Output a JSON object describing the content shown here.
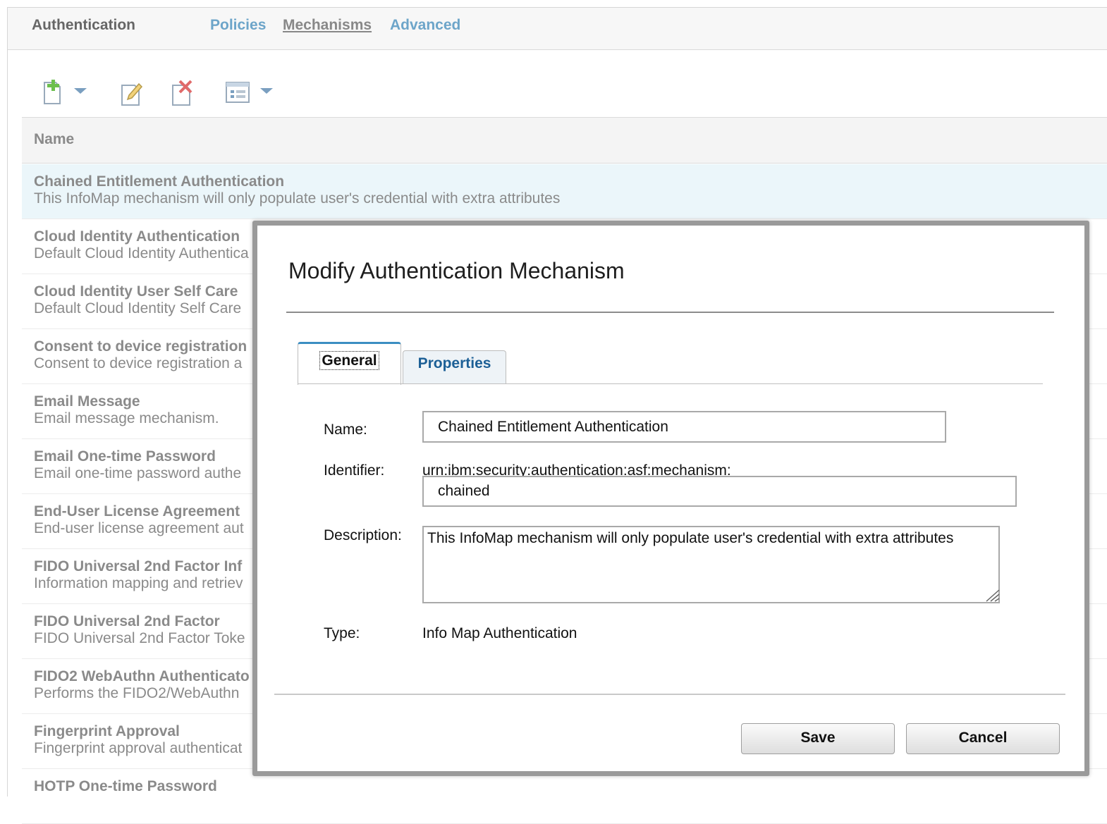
{
  "header": {
    "title": "Authentication",
    "nav": [
      {
        "label": "Policies",
        "active": false
      },
      {
        "label": "Mechanisms",
        "active": true
      },
      {
        "label": "Advanced",
        "active": false
      }
    ]
  },
  "toolbar": {
    "buttons": [
      "add-icon",
      "edit-icon",
      "delete-icon",
      "columns-icon"
    ]
  },
  "grid": {
    "column_header": "Name",
    "rows": [
      {
        "name": "Chained Entitlement Authentication",
        "description": "This InfoMap mechanism will only populate user's credential with extra attributes",
        "selected": true
      },
      {
        "name": "Cloud Identity Authentication",
        "description": "Default Cloud Identity Authentica"
      },
      {
        "name": "Cloud Identity User Self Care",
        "description": "Default Cloud Identity Self Care"
      },
      {
        "name": "Consent to device registration",
        "description": "Consent to device registration a"
      },
      {
        "name": "Email Message",
        "description": "Email message mechanism."
      },
      {
        "name": "Email One-time Password",
        "description": "Email one-time password authe"
      },
      {
        "name": "End-User License Agreement",
        "description": "End-user license agreement aut"
      },
      {
        "name": "FIDO Universal 2nd Factor Inf",
        "description": "Information mapping and retriev"
      },
      {
        "name": "FIDO Universal 2nd Factor",
        "description": "FIDO Universal 2nd Factor Toke"
      },
      {
        "name": "FIDO2 WebAuthn Authenticato",
        "description": "Performs the FIDO2/WebAuthn"
      },
      {
        "name": "Fingerprint Approval",
        "description": "Fingerprint approval authenticat"
      },
      {
        "name": "HOTP One-time Password",
        "description": ""
      }
    ]
  },
  "dialog": {
    "title": "Modify Authentication Mechanism",
    "tabs": [
      {
        "label": "General",
        "active": true
      },
      {
        "label": "Properties",
        "active": false
      }
    ],
    "name_label": "Name:",
    "name_value": "Chained Entitlement Authentication",
    "identifier_label": "Identifier:",
    "identifier_prefix": "urn:ibm:security:authentication:asf:mechanism:",
    "identifier_value": "chained",
    "description_label": "Description:",
    "description_value": "This InfoMap mechanism will only populate user's credential with extra attributes",
    "type_label": "Type:",
    "type_value": "Info Map Authentication",
    "save_label": "Save",
    "cancel_label": "Cancel"
  }
}
